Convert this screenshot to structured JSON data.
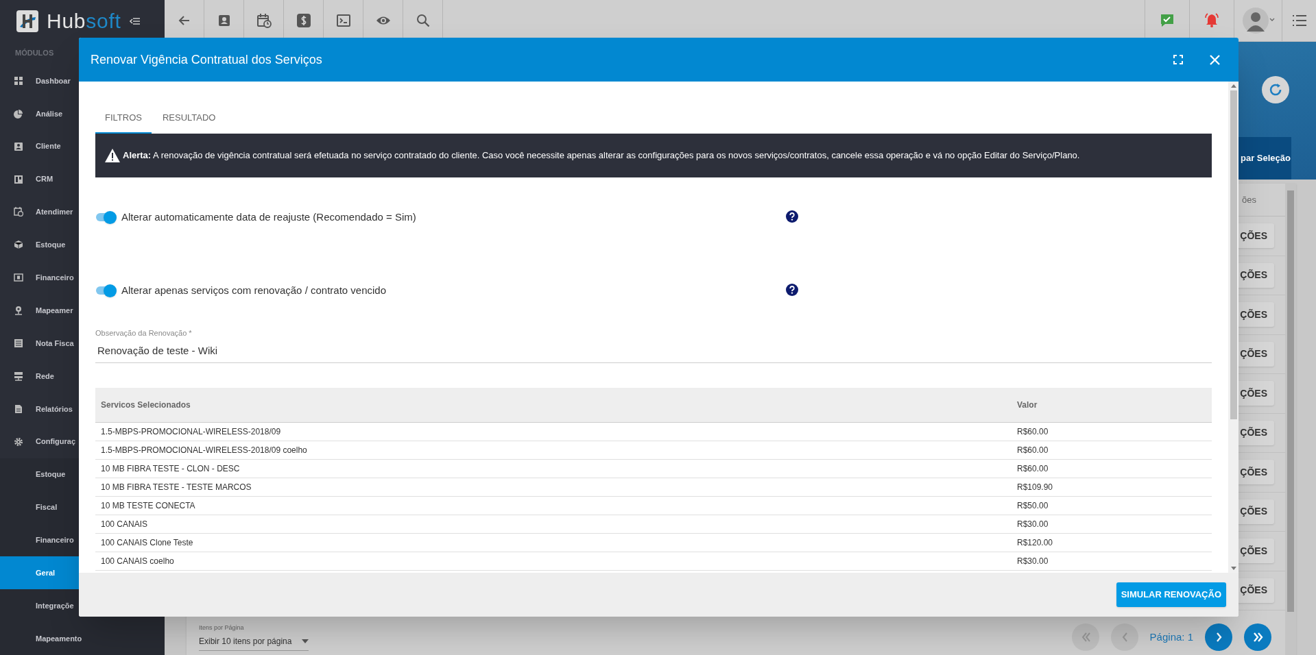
{
  "topbar": {
    "logo": [
      "Hub",
      "soft"
    ]
  },
  "sidebar": {
    "section": "MÓDULOS",
    "items": [
      {
        "label": "Dashboar",
        "kind": "module",
        "selected": false
      },
      {
        "label": "Análise",
        "kind": "module",
        "selected": false
      },
      {
        "label": "Cliente",
        "kind": "module",
        "selected": false
      },
      {
        "label": "CRM",
        "kind": "module",
        "selected": false
      },
      {
        "label": "Atendimer",
        "kind": "module",
        "selected": false
      },
      {
        "label": "Estoque",
        "kind": "module",
        "selected": false
      },
      {
        "label": "Financeiro",
        "kind": "module",
        "selected": false
      },
      {
        "label": "Mapeamer",
        "kind": "module",
        "selected": false
      },
      {
        "label": "Nota Fisca",
        "kind": "module",
        "selected": false
      },
      {
        "label": "Rede",
        "kind": "module",
        "selected": false
      },
      {
        "label": "Relatórios",
        "kind": "module",
        "selected": false
      },
      {
        "label": "Configuraç",
        "kind": "module",
        "selected": false
      },
      {
        "label": "Estoque",
        "kind": "submenu",
        "selected": false
      },
      {
        "label": "Fiscal",
        "kind": "submenu",
        "selected": false
      },
      {
        "label": "Financeiro",
        "kind": "submenu",
        "selected": false
      },
      {
        "label": "Geral",
        "kind": "submenu",
        "selected": true
      },
      {
        "label": "Integraçõe",
        "kind": "submenu",
        "selected": false
      },
      {
        "label": "Mapeamento",
        "kind": "submenu",
        "selected": false
      }
    ]
  },
  "background": {
    "banner_tab": "par Seleção",
    "table_header": "ões",
    "row_buttons": [
      "ÇÕES",
      "ÇÕES",
      "ÇÕES",
      "ÇÕES",
      "ÇÕES",
      "ÇÕES",
      "ÇÕES",
      "ÇÕES",
      "ÇÕES",
      "ÇÕES"
    ],
    "items_per_page": {
      "label": "Itens por Página",
      "value": "Exibir 10 itens por página"
    },
    "pagination": {
      "page_label": "Página: 1",
      "buttons": [
        {
          "kind": "first",
          "disabled": true
        },
        {
          "kind": "prev",
          "disabled": true
        },
        {
          "kind": "next",
          "disabled": false
        },
        {
          "kind": "last",
          "disabled": false
        }
      ]
    }
  },
  "modal": {
    "title": "Renovar Vigência Contratual dos Serviços",
    "tabs": [
      {
        "label": "FILTROS",
        "selected": true
      },
      {
        "label": "RESULTADO",
        "selected": false
      }
    ],
    "alert": "**Alerta:** A renovação de vigência contratual será efetuada no serviço contratado do cliente. Caso você necessite apenas alterar as configurações para os novos serviços/contratos, cancele essa operação e vá no opção Editar do Serviço/Plano.",
    "toggles": [
      {
        "label": "Alterar automaticamente data de reajuste (Recomendado = Sim)",
        "on": true
      },
      {
        "label": "Alterar apenas serviços com renovação / contrato vencido",
        "on": true
      }
    ],
    "field": {
      "label": "Observação da Renovação *",
      "value": "Renovação de teste - Wiki"
    },
    "table": {
      "columns": [
        "Servicos Selecionados",
        "Valor"
      ],
      "rows": [
        [
          "1.5-MBPS-PROMOCIONAL-WIRELESS-2018/09",
          "R$60.00"
        ],
        [
          "1.5-MBPS-PROMOCIONAL-WIRELESS-2018/09 coelho",
          "R$60.00"
        ],
        [
          "10 MB FIBRA TESTE - CLON - DESC",
          "R$60.00"
        ],
        [
          "10 MB FIBRA TESTE - TESTE MARCOS",
          "R$109.90"
        ],
        [
          "10 MB TESTE CONECTA",
          "R$50.00"
        ],
        [
          "100 CANAIS",
          "R$30.00"
        ],
        [
          "100 CANAIS Clone Teste",
          "R$120.00"
        ],
        [
          "100 CANAIS coelho",
          "R$30.00"
        ]
      ]
    },
    "button": "SIMULAR RENOVAÇÃO"
  }
}
